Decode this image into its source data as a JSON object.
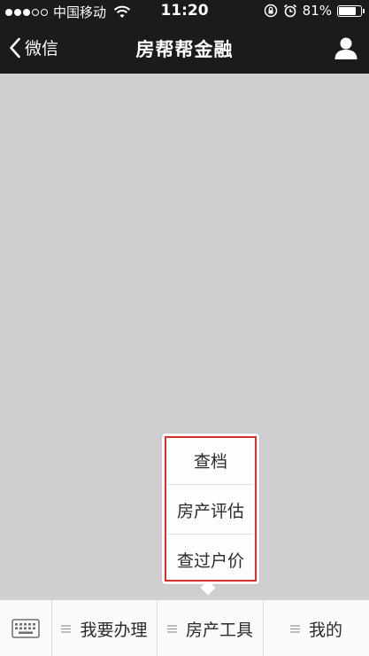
{
  "status_bar": {
    "signal_filled": 3,
    "signal_total": 5,
    "carrier": "中国移动",
    "time": "11:20",
    "battery_percent": "81%",
    "battery_level": 0.81
  },
  "nav": {
    "back_label": "微信",
    "title": "房帮帮金融"
  },
  "popup_menu": {
    "items": [
      "查档",
      "房产评估",
      "查过户价"
    ]
  },
  "bottom_menu": {
    "items": [
      "我要办理",
      "房产工具",
      "我的"
    ]
  },
  "colors": {
    "header_background": "#1b1b1d",
    "content_background": "#cfcfd1",
    "highlight_border": "#d9322c"
  }
}
